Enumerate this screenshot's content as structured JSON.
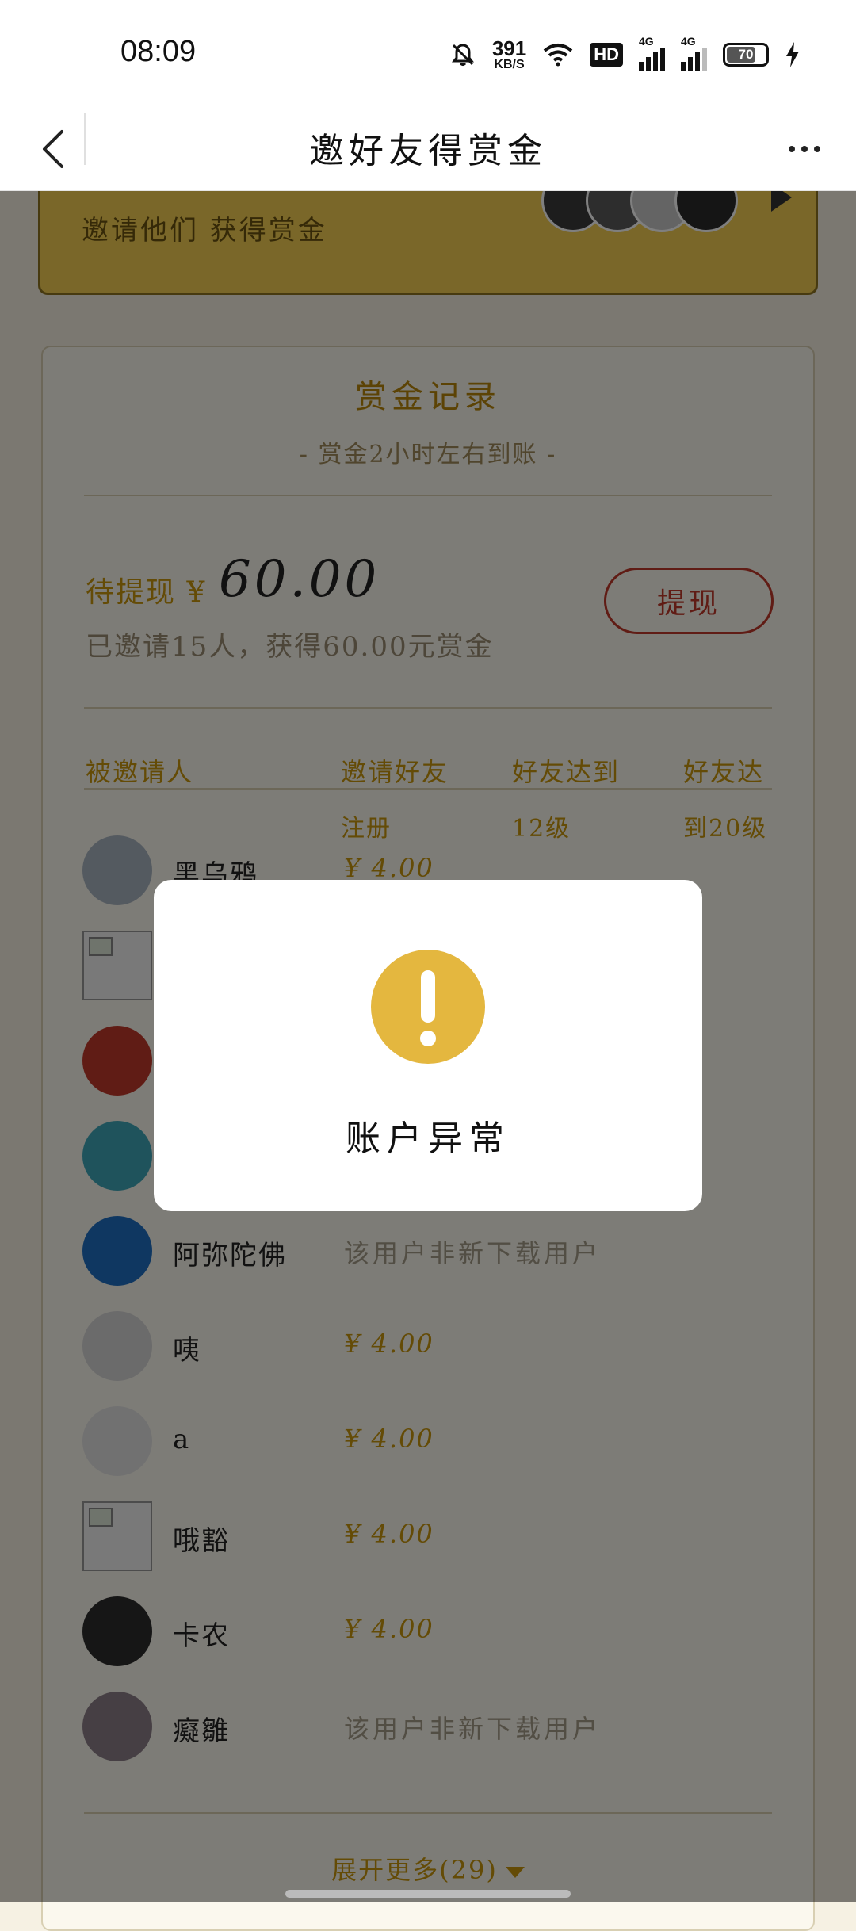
{
  "status_bar": {
    "time": "08:09",
    "net_speed_value": "391",
    "net_speed_unit": "KB/S",
    "hd_label": "HD",
    "signal1_label": "4G",
    "signal2_label": "4G",
    "battery_level": "70"
  },
  "nav": {
    "title": "邀好友得赏金"
  },
  "invite_banner": {
    "subtitle": "邀请他们 获得赏金"
  },
  "record": {
    "title": "赏金记录",
    "subtitle": "- 赏金2小时左右到账 -",
    "pending_label": "待提现 ¥",
    "pending_amount": "60.00",
    "invited_summary": "已邀请15人，获得60.00元赏金",
    "withdraw_label": "提现",
    "columns": [
      "被邀请人",
      "邀请好友",
      "好友达到",
      "好友达"
    ],
    "columns_line2": [
      "注册",
      "12级",
      "到20级"
    ],
    "rows": [
      {
        "name": "黑乌鸦.",
        "value": "¥  4.00"
      },
      {
        "name": "",
        "value": ""
      },
      {
        "name": "",
        "value": ""
      },
      {
        "name": "",
        "value": ""
      },
      {
        "name": "阿弥陀佛",
        "value": "该用户非新下载用户"
      },
      {
        "name": "咦",
        "value": "¥  4.00"
      },
      {
        "name": "a",
        "value": "¥  4.00"
      },
      {
        "name": "哦豁",
        "value": "¥  4.00"
      },
      {
        "name": "卡农",
        "value": "¥  4.00"
      },
      {
        "name": "癡雛",
        "value": "该用户非新下载用户"
      }
    ],
    "expand_label": "展开更多(29)"
  },
  "modal": {
    "message": "账户异常",
    "icon": "exclamation-icon",
    "icon_color": "#e4b73f"
  }
}
